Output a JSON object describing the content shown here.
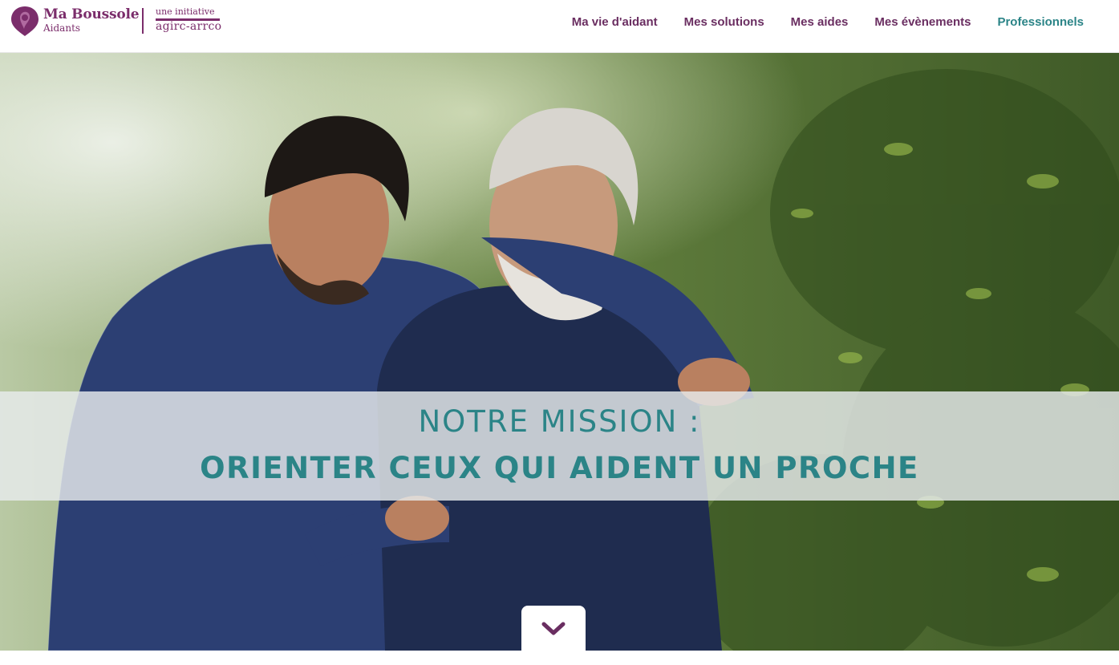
{
  "brand": {
    "title": "Ma Boussole",
    "subtitle": "Aidants",
    "initiative_label": "une initiative",
    "initiative_name": "agirc-arrco",
    "color": "#7b2d6b"
  },
  "nav": {
    "items": [
      {
        "label": "Ma vie d'aidant"
      },
      {
        "label": "Mes solutions"
      },
      {
        "label": "Mes aides"
      },
      {
        "label": "Mes évènements"
      },
      {
        "label": "Professionnels"
      }
    ],
    "color": "#6a2e61",
    "accent": "#2b8487"
  },
  "hero": {
    "line1": "NOTRE MISSION :",
    "line2": "ORIENTER CEUX QUI AIDENT UN PROCHE",
    "scroll_icon": "chevron-down-icon"
  }
}
